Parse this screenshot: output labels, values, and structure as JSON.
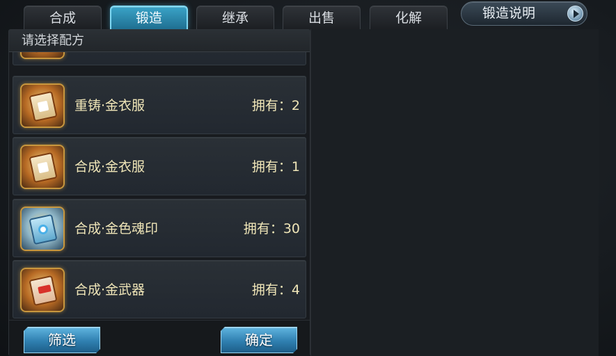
{
  "tabs": [
    {
      "label": "合成",
      "active": false
    },
    {
      "label": "锻造",
      "active": true
    },
    {
      "label": "继承",
      "active": false
    },
    {
      "label": "出售",
      "active": false
    },
    {
      "label": "化解",
      "active": false
    }
  ],
  "help_button": {
    "label": "锻造说明",
    "icon": "play-icon"
  },
  "panel": {
    "title": "请选择配方"
  },
  "recipes": [
    {
      "name": "重铸·金衣服",
      "owned": "拥有：2",
      "icon": "armor-scroll-icon"
    },
    {
      "name": "合成·金衣服",
      "owned": "拥有：1",
      "icon": "armor-scroll-icon"
    },
    {
      "name": "合成·金色魂印",
      "owned": "拥有：30",
      "icon": "soul-seal-scroll-icon"
    },
    {
      "name": "合成·金武器",
      "owned": "拥有：4",
      "icon": "weapon-scroll-icon"
    }
  ],
  "buttons": {
    "filter": "筛选",
    "confirm": "确定"
  },
  "colors": {
    "accent": "#3aa3c7",
    "text_gold": "#f0e6b8"
  }
}
